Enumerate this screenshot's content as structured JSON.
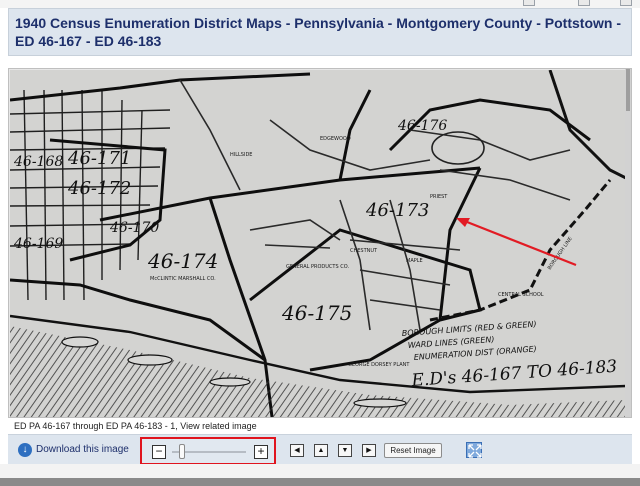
{
  "header": {
    "title": "1940 Census Enumeration District Maps - Pennsylvania - Montgomery County - Pottstown - ED 46-167 - ED 46-183"
  },
  "map": {
    "district_labels": [
      "46-171",
      "46-172",
      "46-174",
      "46-173",
      "46-175",
      "46-176",
      "46-170",
      "46-169",
      "46-168"
    ],
    "legend_lines": [
      "BOROUGH LIMITS (RED & GREEN)",
      "WARD LINES (GREEN)",
      "ENUMERATION DIST (ORANGE)"
    ],
    "range_label": "E.D's 46-167 TO 46-183",
    "place_labels": [
      "McCLINTIC MARSHALL CO.",
      "BOROUGH LINE",
      "CENTRAL SCHOOL",
      "EDGEWOOD",
      "HILLSIDE",
      "GENERAL PRODUCTS CO.",
      "GEORGE DORSEY PLANT",
      "PRIEST",
      "MAPLE",
      "CHESTNUT"
    ],
    "arrow_color": "#e21b24"
  },
  "caption": "ED PA 46-167 through ED PA 46-183 - 1, View related image",
  "toolbar": {
    "download_label": "Download this image",
    "zoom_minus": "−",
    "zoom_plus": "+",
    "zoom_level": 0.1,
    "nav_left": "◀",
    "nav_up": "▲",
    "nav_down": "▼",
    "nav_right": "▶",
    "reset_label": "Reset Image",
    "highlight_color": "#e0141e"
  },
  "icons": {
    "download": "download-circle-icon",
    "fullscreen": "fullscreen-icon"
  }
}
